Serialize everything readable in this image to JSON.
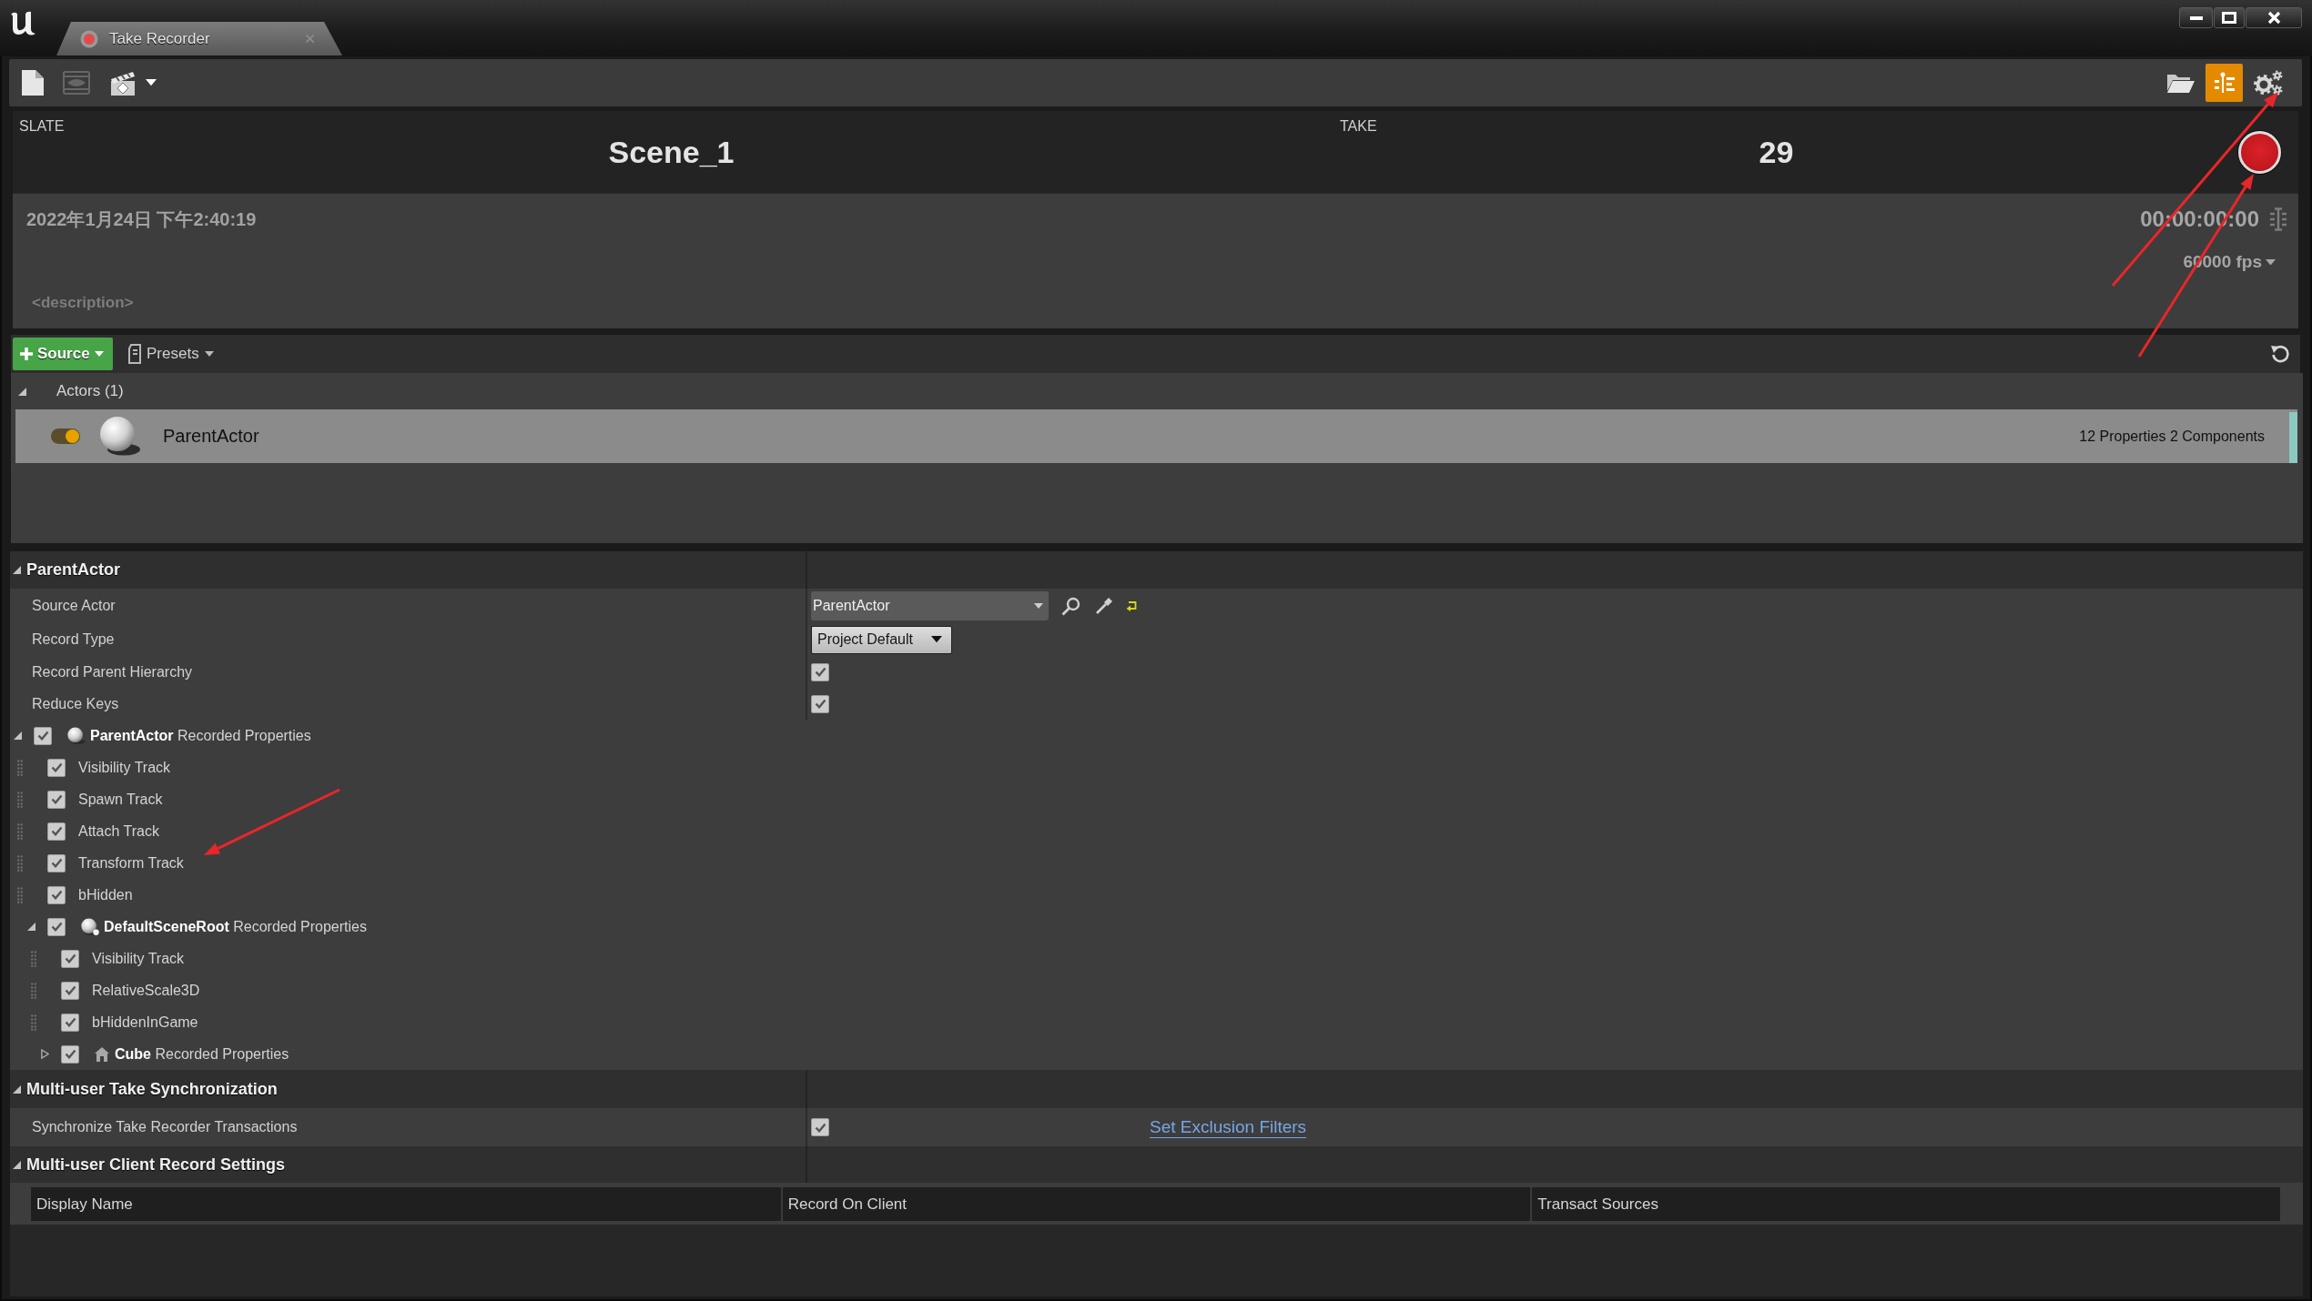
{
  "tab": {
    "title": "Take Recorder"
  },
  "toolbar": {
    "right_buttons": [
      {
        "on": false
      },
      {
        "on": true
      },
      {
        "on": false
      }
    ]
  },
  "slate": {
    "label": "SLATE",
    "value": "Scene_1"
  },
  "take": {
    "label": "TAKE",
    "value": "29"
  },
  "metadata": {
    "timestamp": "2022年1月24日 下午2:40:19",
    "timecode": "00:00:00:00",
    "frame_rate": "60000 fps",
    "description": {
      "placeholder": "<description>"
    }
  },
  "sources_toolbar": {
    "add_button": "Source",
    "presets_button": "Presets"
  },
  "actors": {
    "title": "Actors (1)",
    "expanded": true,
    "items": [
      {
        "name": "ParentActor",
        "enabled": true,
        "selected": true,
        "summary": "12 Properties 2 Components"
      }
    ]
  },
  "details": [
    {
      "title": "ParentActor",
      "expanded": true,
      "rows": [
        {
          "kind": "actor_picker",
          "label": "Source Actor",
          "value": "ParentActor"
        },
        {
          "kind": "dropdown",
          "label": "Record Type",
          "value": "Project Default"
        },
        {
          "kind": "checkbox",
          "label": "Record Parent Hierarchy",
          "checked": true
        },
        {
          "kind": "checkbox",
          "label": "Reduce Keys",
          "checked": true
        }
      ],
      "tree": [
        {
          "kind": "actor_group",
          "label": "**ParentActor** Recorded Properties",
          "checked": true,
          "expanded": true,
          "children": [
            {
              "kind": "property",
              "label": "Visibility Track",
              "checked": true
            },
            {
              "kind": "property",
              "label": "Spawn Track",
              "checked": true
            },
            {
              "kind": "property",
              "label": "Attach Track",
              "checked": true
            },
            {
              "kind": "property",
              "label": "Transform Track",
              "checked": true
            },
            {
              "kind": "property",
              "label": "bHidden",
              "checked": true
            },
            {
              "kind": "component_group",
              "label": "**DefaultSceneRoot** Recorded Properties",
              "checked": true,
              "expanded": true,
              "children": [
                {
                  "kind": "property",
                  "label": "Visibility Track",
                  "checked": true
                },
                {
                  "kind": "property",
                  "label": "RelativeScale3D",
                  "checked": true
                },
                {
                  "kind": "property",
                  "label": "bHiddenInGame",
                  "checked": true
                },
                {
                  "kind": "mesh_group",
                  "label": "**Cube** Recorded Properties",
                  "checked": true,
                  "expanded": false
                }
              ]
            }
          ]
        }
      ]
    },
    {
      "title": "Multi-user Take Synchronization",
      "expanded": true,
      "rows": [
        {
          "kind": "checkbox_link",
          "label": "Synchronize Take Recorder Transactions",
          "checked": true,
          "link": "Set Exclusion Filters"
        }
      ]
    },
    {
      "title": "Multi-user Client Record Settings",
      "expanded": true,
      "table": {
        "columns": [
          "Display Name",
          "Record On Client",
          "Transact Sources"
        ]
      }
    }
  ],
  "annotations": [
    {
      "kind": "arrow"
    },
    {
      "kind": "arrow"
    },
    {
      "kind": "arrow"
    }
  ]
}
